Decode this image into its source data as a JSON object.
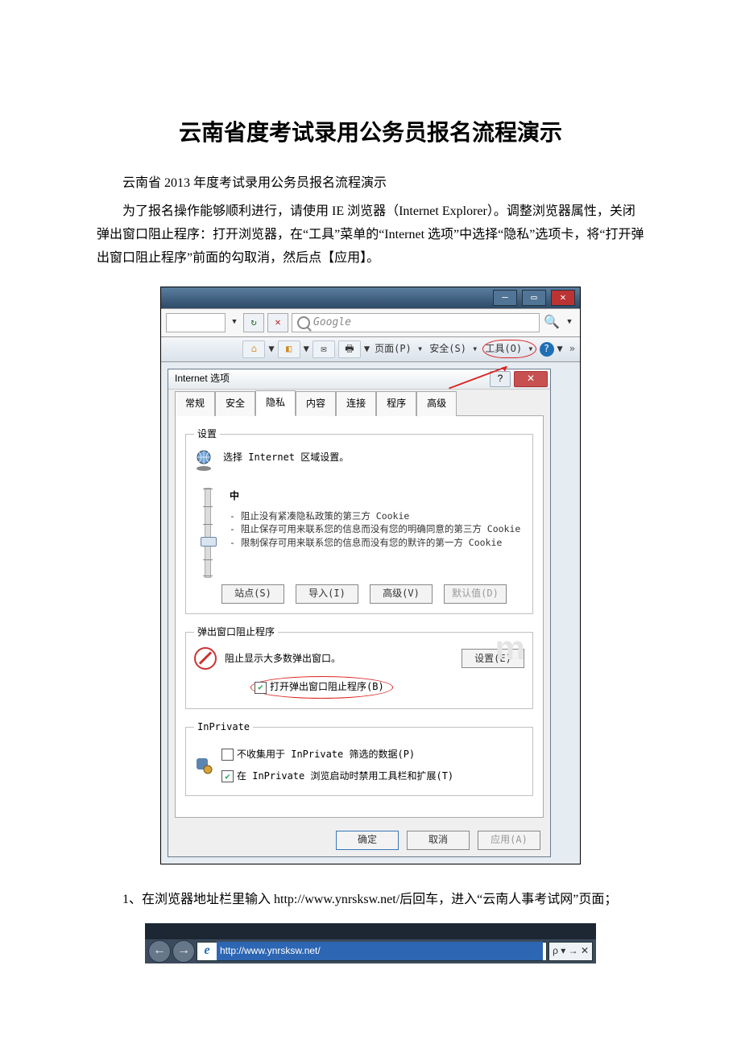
{
  "title": "云南省度考试录用公务员报名流程演示",
  "intro_line": "云南省 2013 年度考试录用公务员报名流程演示",
  "intro_para": "为了报名操作能够顺利进行，请使用 IE 浏览器（Internet Explorer）。调整浏览器属性，关闭弹出窗口阻止程序：打开浏览器，在“工具”菜单的“Internet 选项”中选择“隐私”选项卡，将“打开弹出窗口阻止程序”前面的勾取消，然后点【应用】。",
  "step1": "1、在浏览器地址栏里输入 http://www.ynrsksw.net/后回车，进入“云南人事考试网”页面；",
  "ie": {
    "search_placeholder": "Google",
    "toolbar": {
      "page": "页面(P)",
      "safety": "安全(S)",
      "tools": "工具(O)",
      "more": "»"
    }
  },
  "dialog": {
    "title": "Internet 选项",
    "tabs": [
      "常规",
      "安全",
      "隐私",
      "内容",
      "连接",
      "程序",
      "高级"
    ],
    "active_tab_index": 2,
    "settings": {
      "legend": "设置",
      "desc": "选择 Internet 区域设置。",
      "level": "中",
      "bullets": "- 阻止没有紧凑隐私政策的第三方 Cookie\n- 阻止保存可用来联系您的信息而没有您的明确同意的第三方 Cookie\n- 限制保存可用来联系您的信息而没有您的默许的第一方 Cookie",
      "buttons": {
        "sites": "站点(S)",
        "import": "导入(I)",
        "advanced": "高级(V)",
        "defaults": "默认值(D)"
      }
    },
    "popup": {
      "legend": "弹出窗口阻止程序",
      "desc": "阻止显示大多数弹出窗口。",
      "settings_btn": "设置(E)",
      "checkbox": "打开弹出窗口阻止程序(B)",
      "checked": true
    },
    "inprivate": {
      "legend": "InPrivate",
      "cb1": {
        "label": "不收集用于 InPrivate 筛选的数据(P)",
        "checked": false
      },
      "cb2": {
        "label": "在 InPrivate 浏览启动时禁用工具栏和扩展(T)",
        "checked": true
      }
    },
    "footer": {
      "ok": "确定",
      "cancel": "取消",
      "apply": "应用(A)"
    }
  },
  "address_bar": {
    "url": "http://www.ynrsksw.net/",
    "right": "ρ ▾ → ✕"
  }
}
